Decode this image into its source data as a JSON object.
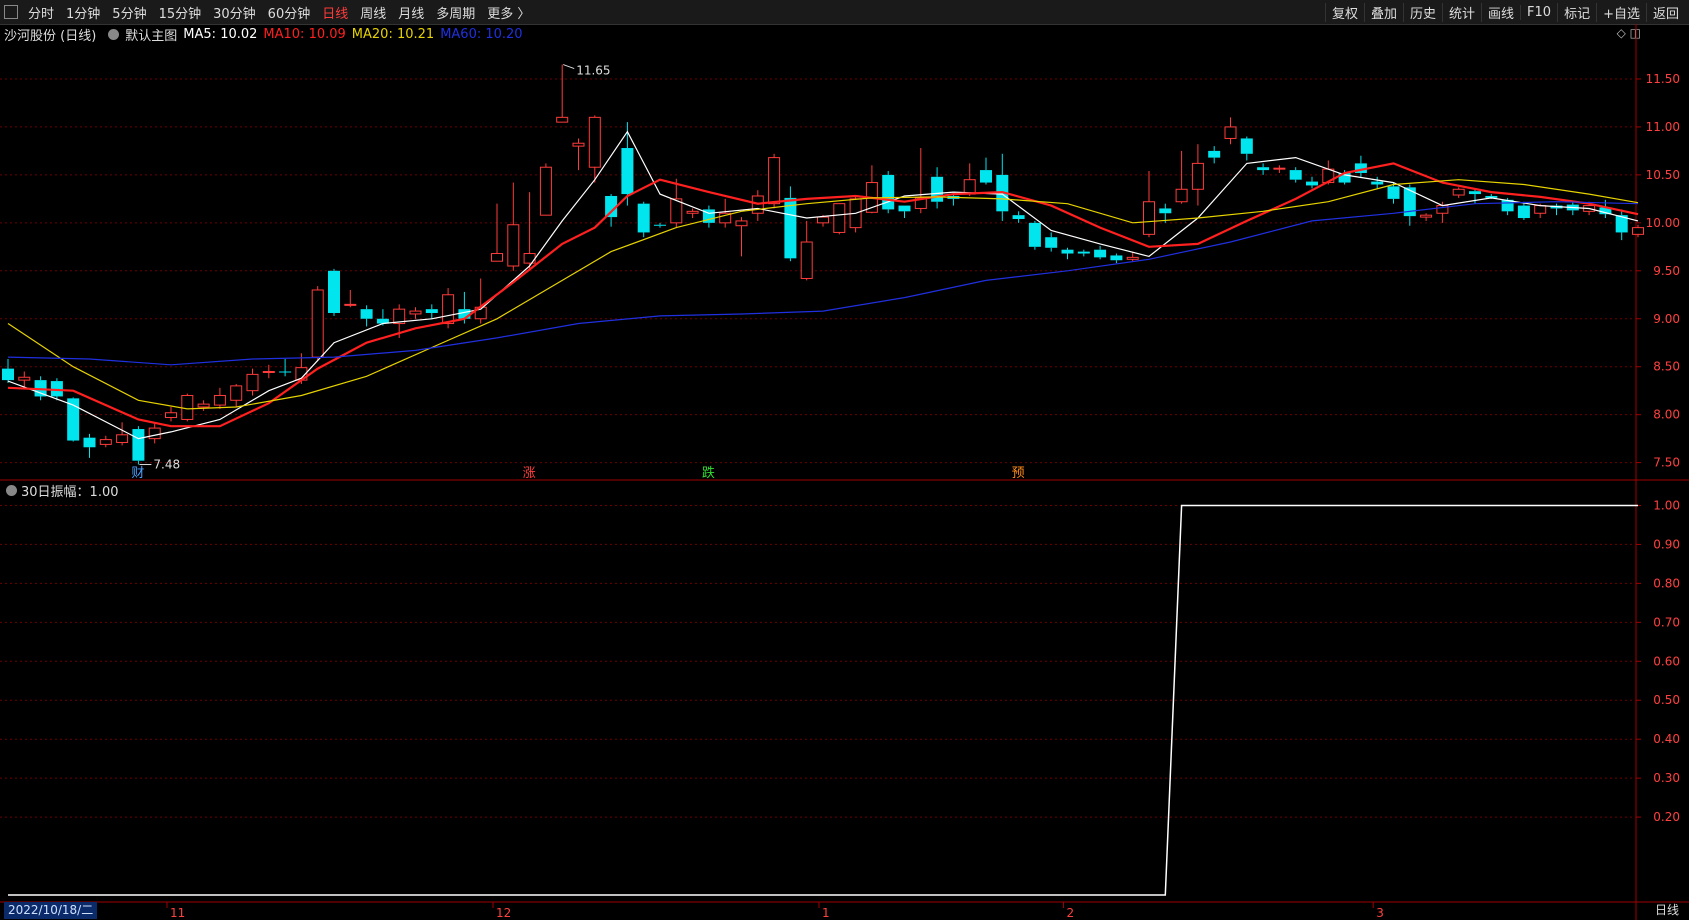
{
  "toolbar": {
    "left": [
      {
        "label": "分时",
        "active": false
      },
      {
        "label": "1分钟",
        "active": false
      },
      {
        "label": "5分钟",
        "active": false
      },
      {
        "label": "15分钟",
        "active": false
      },
      {
        "label": "30分钟",
        "active": false
      },
      {
        "label": "60分钟",
        "active": false
      },
      {
        "label": "日线",
        "active": true
      },
      {
        "label": "周线",
        "active": false
      },
      {
        "label": "月线",
        "active": false
      },
      {
        "label": "多周期",
        "active": false
      },
      {
        "label": "更多 〉",
        "active": false
      }
    ],
    "right": [
      "复权",
      "叠加",
      "历史",
      "统计",
      "画线",
      "F10",
      "标记",
      "+自选",
      "返回"
    ]
  },
  "legend": {
    "title": "沙河股份 (日线)",
    "indicator": "默认主图",
    "ma5": "MA5: 10.02",
    "ma10": "MA10: 10.09",
    "ma20": "MA20: 10.21",
    "ma60": "MA60: 10.20"
  },
  "sub_legend": "30日振幅：1.00",
  "status": {
    "date": "2022/10/18/二",
    "period": "日线"
  },
  "colors": {
    "up": "#ff3b3b",
    "down": "#00e5ee",
    "ma5": "#ffffff",
    "ma10": "#ff2020",
    "ma20": "#e6d200",
    "ma60": "#2030e0",
    "grid": "#6a0000"
  },
  "chart_data": [
    {
      "type": "candlestick",
      "title": "沙河股份 (日线)",
      "ylim": [
        7.35,
        11.75
      ],
      "yticks": [
        "11.50",
        "11.00",
        "10.50",
        "10.00",
        "9.50",
        "9.00",
        "8.50",
        "8.00",
        "7.50"
      ],
      "x_labels": [
        "11",
        "12",
        "1",
        "2",
        "3"
      ],
      "annotations": {
        "high": "11.65",
        "low": "7.48"
      },
      "event_markers": [
        {
          "text": "财",
          "color": "#4aa0ff"
        },
        {
          "text": "涨",
          "color": "#ff3b3b"
        },
        {
          "text": "跌",
          "color": "#33dd33"
        },
        {
          "text": "预",
          "color": "#ff8c1a"
        }
      ],
      "candles": [
        [
          8.48,
          8.36,
          8.58,
          8.33
        ],
        [
          8.36,
          8.39,
          8.45,
          8.28
        ],
        [
          8.36,
          8.19,
          8.4,
          8.15
        ],
        [
          8.35,
          8.19,
          8.38,
          8.15
        ],
        [
          8.17,
          7.73,
          8.18,
          7.72
        ],
        [
          7.76,
          7.66,
          7.8,
          7.55
        ],
        [
          7.69,
          7.74,
          7.78,
          7.66
        ],
        [
          7.71,
          7.79,
          7.92,
          7.68
        ],
        [
          7.85,
          7.52,
          7.88,
          7.48
        ],
        [
          7.75,
          7.86,
          7.92,
          7.7
        ],
        [
          7.97,
          8.02,
          8.08,
          7.93
        ],
        [
          7.95,
          8.2,
          8.22,
          7.93
        ],
        [
          8.08,
          8.11,
          8.15,
          8.04
        ],
        [
          8.1,
          8.2,
          8.28,
          8.06
        ],
        [
          8.15,
          8.3,
          8.32,
          8.08
        ],
        [
          8.25,
          8.42,
          8.48,
          8.2
        ],
        [
          8.45,
          8.45,
          8.52,
          8.38
        ],
        [
          8.45,
          8.44,
          8.58,
          8.4
        ],
        [
          8.36,
          8.49,
          8.64,
          8.32
        ],
        [
          8.6,
          9.3,
          9.34,
          8.56
        ],
        [
          9.5,
          9.06,
          9.52,
          9.03
        ],
        [
          9.15,
          9.15,
          9.3,
          9.12
        ],
        [
          9.1,
          9.0,
          9.14,
          8.92
        ],
        [
          9.0,
          8.95,
          9.1,
          8.93
        ],
        [
          8.95,
          9.1,
          9.15,
          8.8
        ],
        [
          9.05,
          9.08,
          9.12,
          9.0
        ],
        [
          9.1,
          9.06,
          9.15,
          9.0
        ],
        [
          8.95,
          9.25,
          9.32,
          8.9
        ],
        [
          9.1,
          9.0,
          9.28,
          8.95
        ],
        [
          9.0,
          9.12,
          9.42,
          8.95
        ],
        [
          9.6,
          9.68,
          10.2,
          9.6
        ],
        [
          9.55,
          9.98,
          10.42,
          9.5
        ],
        [
          9.58,
          9.68,
          10.32,
          9.52
        ],
        [
          10.08,
          10.58,
          10.62,
          10.08
        ],
        [
          11.05,
          11.1,
          11.65,
          11.05
        ],
        [
          10.8,
          10.83,
          10.88,
          10.55
        ],
        [
          10.58,
          11.1,
          11.12,
          10.42
        ],
        [
          10.28,
          10.06,
          10.3,
          9.96
        ],
        [
          10.78,
          10.3,
          11.05,
          10.18
        ],
        [
          10.2,
          9.9,
          10.22,
          9.85
        ],
        [
          9.98,
          9.97,
          10.0,
          9.95
        ],
        [
          10.0,
          10.25,
          10.46,
          9.95
        ],
        [
          10.1,
          10.12,
          10.15,
          10.05
        ],
        [
          10.14,
          10.0,
          10.18,
          9.95
        ],
        [
          10.0,
          10.1,
          10.25,
          9.95
        ],
        [
          9.97,
          10.02,
          10.06,
          9.65
        ],
        [
          10.1,
          10.28,
          10.34,
          10.02
        ],
        [
          10.2,
          10.68,
          10.72,
          10.15
        ],
        [
          10.26,
          9.63,
          10.38,
          9.6
        ],
        [
          9.42,
          9.8,
          10.02,
          9.4
        ],
        [
          10.0,
          10.06,
          10.08,
          9.96
        ],
        [
          9.9,
          10.2,
          10.2,
          9.88
        ],
        [
          9.95,
          10.25,
          10.27,
          9.9
        ],
        [
          10.11,
          10.42,
          10.6,
          10.1
        ],
        [
          10.5,
          10.14,
          10.54,
          10.1
        ],
        [
          10.18,
          10.12,
          10.18,
          10.05
        ],
        [
          10.15,
          10.26,
          10.78,
          10.1
        ],
        [
          10.48,
          10.22,
          10.58,
          10.15
        ],
        [
          10.28,
          10.25,
          10.3,
          10.18
        ],
        [
          10.3,
          10.45,
          10.62,
          10.28
        ],
        [
          10.55,
          10.42,
          10.68,
          10.4
        ],
        [
          10.5,
          10.12,
          10.72,
          10.02
        ],
        [
          10.08,
          10.04,
          10.12,
          10.0
        ],
        [
          10.0,
          9.75,
          10.02,
          9.72
        ],
        [
          9.85,
          9.74,
          9.9,
          9.7
        ],
        [
          9.72,
          9.68,
          9.74,
          9.62
        ],
        [
          9.7,
          9.68,
          9.72,
          9.65
        ],
        [
          9.72,
          9.64,
          9.76,
          9.62
        ],
        [
          9.66,
          9.61,
          9.68,
          9.58
        ],
        [
          9.62,
          9.64,
          9.7,
          9.6
        ],
        [
          9.88,
          10.22,
          10.54,
          9.85
        ],
        [
          10.15,
          10.1,
          10.2,
          10.0
        ],
        [
          10.22,
          10.35,
          10.75,
          10.2
        ],
        [
          10.35,
          10.62,
          10.82,
          10.18
        ],
        [
          10.75,
          10.68,
          10.8,
          10.62
        ],
        [
          10.88,
          11.0,
          11.1,
          10.82
        ],
        [
          10.88,
          10.72,
          10.9,
          10.65
        ],
        [
          10.58,
          10.55,
          10.62,
          10.5
        ],
        [
          10.57,
          10.57,
          10.6,
          10.52
        ],
        [
          10.55,
          10.45,
          10.58,
          10.42
        ],
        [
          10.43,
          10.39,
          10.48,
          10.36
        ],
        [
          10.42,
          10.56,
          10.65,
          10.4
        ],
        [
          10.52,
          10.42,
          10.55,
          10.4
        ],
        [
          10.62,
          10.52,
          10.7,
          10.48
        ],
        [
          10.43,
          10.4,
          10.48,
          10.36
        ],
        [
          10.38,
          10.25,
          10.42,
          10.2
        ],
        [
          10.37,
          10.07,
          10.4,
          9.97
        ],
        [
          10.06,
          10.08,
          10.1,
          10.02
        ],
        [
          10.1,
          10.18,
          10.22,
          10.0
        ],
        [
          10.29,
          10.35,
          10.37,
          10.26
        ],
        [
          10.33,
          10.3,
          10.36,
          10.2
        ],
        [
          10.28,
          10.26,
          10.3,
          10.25
        ],
        [
          10.24,
          10.12,
          10.26,
          10.08
        ],
        [
          10.18,
          10.05,
          10.22,
          10.03
        ],
        [
          10.1,
          10.18,
          10.2,
          10.05
        ],
        [
          10.18,
          10.15,
          10.2,
          10.08
        ],
        [
          10.19,
          10.13,
          10.22,
          10.08
        ],
        [
          10.12,
          10.18,
          10.22,
          10.08
        ],
        [
          10.16,
          10.09,
          10.24,
          10.05
        ],
        [
          10.08,
          9.9,
          10.14,
          9.82
        ],
        [
          9.88,
          9.95,
          9.98,
          9.85
        ]
      ],
      "series": [
        {
          "name": "MA5",
          "color": "#ffffff",
          "x": [
            0,
            4,
            8,
            10,
            13,
            16,
            18,
            20,
            23,
            26,
            29,
            32,
            34,
            36,
            38,
            40,
            43,
            46,
            49,
            52,
            55,
            58,
            61,
            64,
            67,
            70,
            73,
            76,
            79,
            82,
            85,
            88,
            91,
            94,
            97,
            100
          ],
          "values": [
            8.35,
            8.1,
            7.75,
            7.82,
            7.95,
            8.25,
            8.38,
            8.75,
            8.95,
            9.0,
            9.1,
            9.55,
            10.02,
            10.45,
            10.95,
            10.3,
            10.1,
            10.15,
            10.05,
            10.1,
            10.28,
            10.32,
            10.3,
            9.92,
            9.78,
            9.65,
            10.05,
            10.62,
            10.68,
            10.5,
            10.42,
            10.18,
            10.26,
            10.18,
            10.15,
            10.02
          ]
        },
        {
          "name": "MA10",
          "color": "#ff2020",
          "x": [
            0,
            4,
            8,
            10,
            13,
            16,
            19,
            22,
            25,
            28,
            31,
            34,
            36,
            38,
            40,
            43,
            46,
            49,
            52,
            55,
            58,
            61,
            64,
            67,
            70,
            73,
            76,
            79,
            82,
            85,
            88,
            91,
            94,
            97,
            100
          ],
          "values": [
            8.28,
            8.25,
            7.95,
            7.88,
            7.88,
            8.12,
            8.48,
            8.75,
            8.9,
            9.0,
            9.38,
            9.78,
            9.95,
            10.28,
            10.45,
            10.32,
            10.2,
            10.25,
            10.28,
            10.22,
            10.3,
            10.32,
            10.18,
            9.95,
            9.75,
            9.78,
            10.02,
            10.25,
            10.52,
            10.62,
            10.42,
            10.32,
            10.27,
            10.2,
            10.09
          ]
        },
        {
          "name": "MA20",
          "color": "#e6d200",
          "x": [
            0,
            4,
            8,
            11,
            14,
            18,
            22,
            26,
            30,
            33,
            37,
            41,
            45,
            49,
            53,
            57,
            61,
            65,
            69,
            73,
            77,
            81,
            85,
            89,
            93,
            97,
            100
          ],
          "values": [
            8.95,
            8.5,
            8.15,
            8.06,
            8.08,
            8.2,
            8.4,
            8.7,
            9.0,
            9.3,
            9.7,
            9.95,
            10.12,
            10.2,
            10.26,
            10.27,
            10.25,
            10.2,
            10.0,
            10.05,
            10.12,
            10.22,
            10.4,
            10.45,
            10.4,
            10.3,
            10.21
          ]
        },
        {
          "name": "MA60",
          "color": "#2030e0",
          "x": [
            0,
            5,
            10,
            15,
            20,
            25,
            30,
            35,
            40,
            45,
            50,
            55,
            60,
            65,
            70,
            75,
            80,
            85,
            90,
            95,
            100
          ],
          "values": [
            8.6,
            8.58,
            8.52,
            8.58,
            8.6,
            8.67,
            8.8,
            8.95,
            9.03,
            9.05,
            9.08,
            9.22,
            9.4,
            9.5,
            9.62,
            9.8,
            10.02,
            10.1,
            10.2,
            10.22,
            10.2
          ]
        }
      ]
    },
    {
      "type": "line",
      "title": "30日振幅",
      "ylim": [
        0.0,
        1.05
      ],
      "yticks": [
        "1.00",
        "0.90",
        "0.80",
        "0.70",
        "0.60",
        "0.50",
        "0.40",
        "0.30",
        "0.20"
      ],
      "series": [
        {
          "name": "30日振幅",
          "color": "#ffffff",
          "x": [
            0,
            71,
            72,
            100
          ],
          "values": [
            0,
            0,
            1.0,
            1.0
          ]
        }
      ]
    }
  ]
}
